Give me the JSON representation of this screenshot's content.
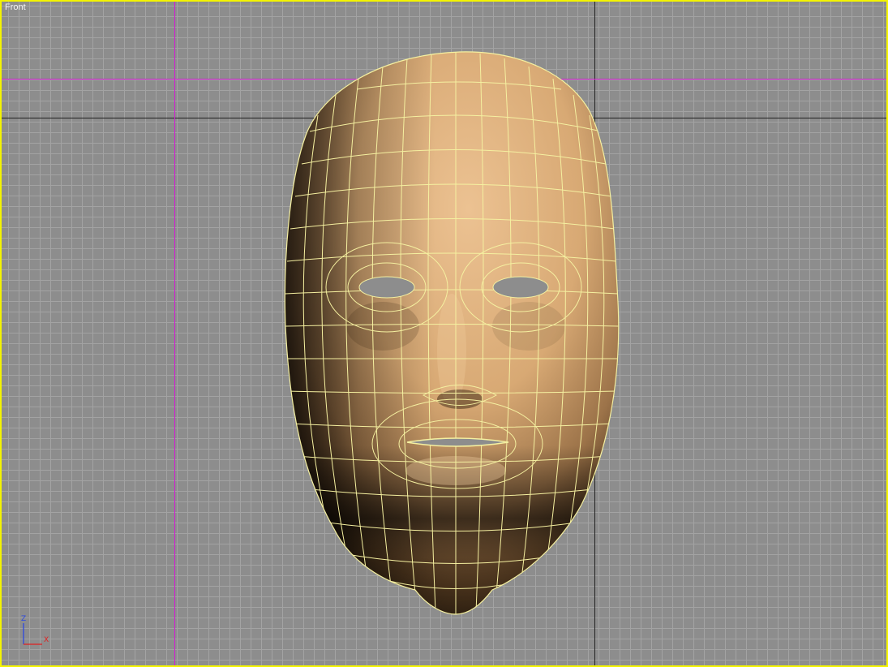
{
  "viewport": {
    "label": "Front",
    "active_border_color": "#f4f400",
    "background_color": "#8d8d8d",
    "grid_color": "#a3a3a3",
    "home_grid_color": "#222222",
    "guide_color": "#d21bd2"
  },
  "model": {
    "name": "head-mesh",
    "skin_color": "#e4b888",
    "wire_color": "#f5f0a0"
  },
  "axis_tripod": {
    "z_label": "Z",
    "x_label": "X",
    "z_color": "#2c48e0",
    "x_color": "#e02020"
  }
}
